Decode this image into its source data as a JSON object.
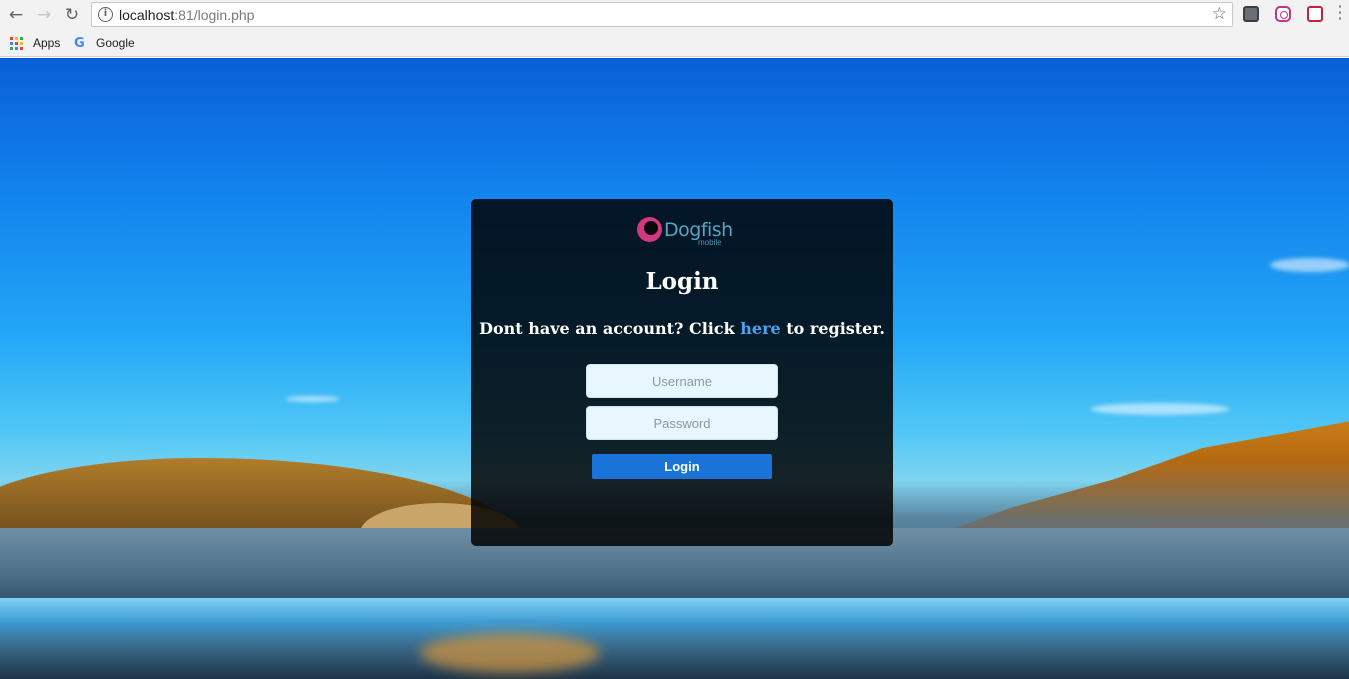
{
  "browser": {
    "url_host": "localhost",
    "url_rest": ":81/login.php",
    "bookmarks": [
      {
        "label": "Apps",
        "icon": "apps-grid-icon"
      },
      {
        "label": "Google",
        "icon": "google-g-icon"
      }
    ],
    "extensions": [
      "profile-extension-icon",
      "instagram-icon",
      "pocket-icon"
    ]
  },
  "login_card": {
    "logo_text": "Dogfish",
    "logo_subtext": "mobile",
    "title": "Login",
    "register_prefix": "Dont have an account? Click ",
    "register_link": "here",
    "register_suffix": " to register.",
    "username_placeholder": "Username",
    "password_placeholder": "Password",
    "login_button": "Login"
  },
  "colors": {
    "link": "#4aa3f0",
    "button": "#1a73d9",
    "logo_mark": "#d2387f",
    "logo_text": "#55a6c5"
  }
}
